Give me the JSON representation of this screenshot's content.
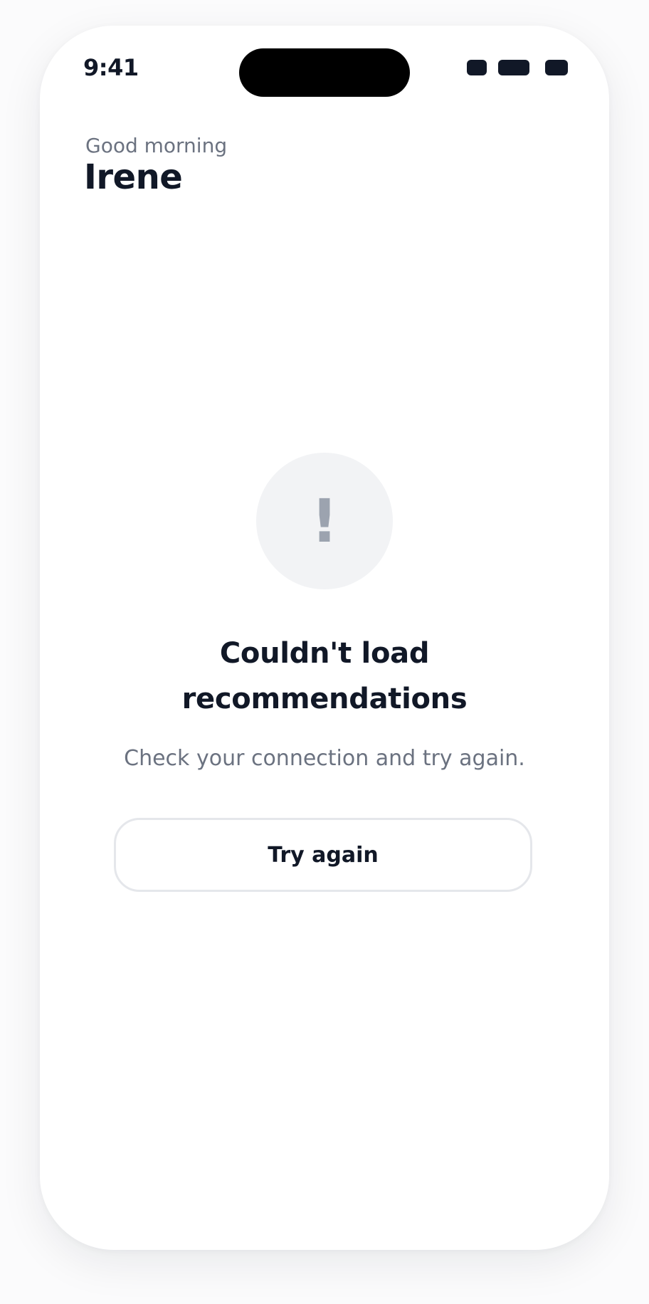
{
  "status_bar": {
    "time": "9:41",
    "icons": [
      "signal-icon",
      "wifi-icon",
      "battery-icon"
    ]
  },
  "header": {
    "greeting": "Good morning",
    "username": "Irene"
  },
  "error_state": {
    "icon": "exclamation-icon",
    "icon_glyph": "!",
    "title": "Couldn't load recommendations",
    "message": "Check your connection and try again.",
    "retry_label": "Try again"
  },
  "colors": {
    "text_primary": "#111827",
    "text_secondary": "#6b7280",
    "icon_bg": "#f2f3f5",
    "icon_fg": "#9ca3af",
    "button_border": "#e5e7eb"
  }
}
